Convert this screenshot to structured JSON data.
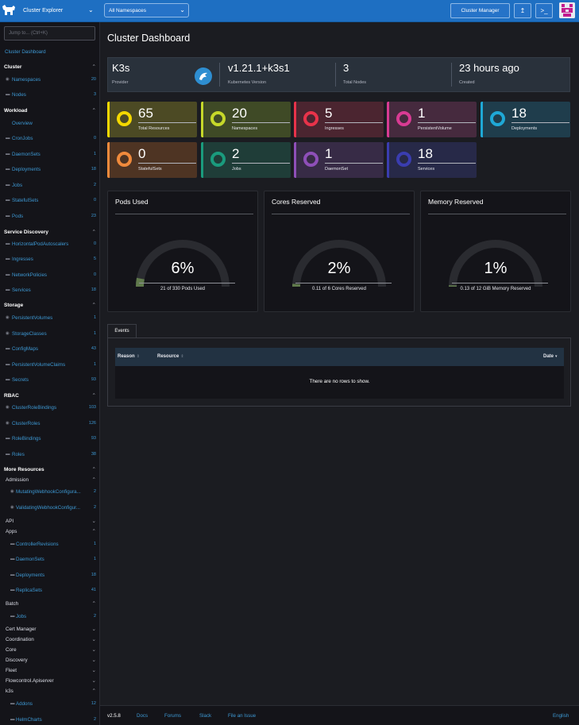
{
  "header": {
    "cluster_label": "Cluster Explorer",
    "namespace_select": "All Namespaces",
    "cluster_manager_label": "Cluster Manager",
    "colors": {
      "bar": "#1e6fc2",
      "border": "#8fb9e6"
    }
  },
  "sidebar": {
    "search_placeholder": "Jump to... (Ctrl+K)",
    "dashboard_link": "Cluster Dashboard",
    "groups": {
      "cluster": "Cluster",
      "workload": "Workload",
      "service_discovery": "Service Discovery",
      "storage": "Storage",
      "rbac": "RBAC",
      "more_resources": "More Resources",
      "admission": "Admission",
      "api": "API",
      "apps": "Apps",
      "batch": "Batch",
      "cert_manager": "Cert Manager",
      "coordination": "Coordination",
      "core": "Core",
      "discovery": "Discovery",
      "fleet": "Fleet",
      "flowcontrol": "Flowcontrol.Apiserver",
      "k3s": "k3s"
    },
    "items": {
      "namespaces": {
        "label": "Namespaces",
        "count": "20"
      },
      "nodes": {
        "label": "Nodes",
        "count": "3"
      },
      "overview": {
        "label": "Overview"
      },
      "cronjobs": {
        "label": "CronJobs",
        "count": "0"
      },
      "daemonsets": {
        "label": "DaemonSets",
        "count": "1"
      },
      "deployments": {
        "label": "Deployments",
        "count": "18"
      },
      "jobs": {
        "label": "Jobs",
        "count": "2"
      },
      "statefulsets": {
        "label": "StatefulSets",
        "count": "0"
      },
      "pods": {
        "label": "Pods",
        "count": "23"
      },
      "hpa": {
        "label": "HorizontalPodAutoscalers",
        "count": "0"
      },
      "ingresses": {
        "label": "Ingresses",
        "count": "5"
      },
      "networkpolicies": {
        "label": "NetworkPolicies",
        "count": "0"
      },
      "services": {
        "label": "Services",
        "count": "18"
      },
      "pv": {
        "label": "PersistentVolumes",
        "count": "1"
      },
      "storageclasses": {
        "label": "StorageClasses",
        "count": "1"
      },
      "configmaps": {
        "label": "ConfigMaps",
        "count": "43"
      },
      "pvc": {
        "label": "PersistentVolumeClaims",
        "count": "1"
      },
      "secrets": {
        "label": "Secrets",
        "count": "93"
      },
      "crb": {
        "label": "ClusterRoleBindings",
        "count": "103"
      },
      "clusterroles": {
        "label": "ClusterRoles",
        "count": "126"
      },
      "rolebindings": {
        "label": "RoleBindings",
        "count": "93"
      },
      "roles": {
        "label": "Roles",
        "count": "38"
      },
      "mutating": {
        "label": "MutatingWebhookConfigura...",
        "count": "2"
      },
      "validating": {
        "label": "ValidatingWebhookConfigur...",
        "count": "2"
      },
      "controllerrevisions": {
        "label": "ControllerRevisions",
        "count": "1"
      },
      "apps_daemonsets": {
        "label": "DaemonSets",
        "count": "1"
      },
      "apps_deployments": {
        "label": "Deployments",
        "count": "18"
      },
      "replicasets": {
        "label": "ReplicaSets",
        "count": "41"
      },
      "batch_jobs": {
        "label": "Jobs",
        "count": "2"
      },
      "addons": {
        "label": "Addons",
        "count": "12"
      },
      "helmcharts": {
        "label": "HelmCharts",
        "count": "2"
      }
    }
  },
  "main": {
    "title": "Cluster Dashboard",
    "info": [
      {
        "value": "K3s",
        "label": "Provider"
      },
      {
        "value": "v1.21.1+k3s1",
        "label": "Kubernetes Version"
      },
      {
        "value": "3",
        "label": "Total Nodes"
      },
      {
        "value": "23 hours ago",
        "label": "Created"
      }
    ],
    "tiles": [
      {
        "count": "65",
        "label": "Total Resources",
        "color": "#f4d800",
        "bg": "#4c4a24"
      },
      {
        "count": "20",
        "label": "Namespaces",
        "color": "#c6d82a",
        "bg": "#3f4a26"
      },
      {
        "count": "5",
        "label": "Ingresses",
        "color": "#e8334a",
        "bg": "#4b2530"
      },
      {
        "count": "1",
        "label": "PersistentVolume",
        "color": "#d83b93",
        "bg": "#462a3e"
      },
      {
        "count": "18",
        "label": "Deployments",
        "color": "#1fa8d6",
        "bg": "#1f3d4c"
      },
      {
        "count": "0",
        "label": "StatefulSets",
        "color": "#f08a3c",
        "bg": "#4e3423"
      },
      {
        "count": "2",
        "label": "Jobs",
        "color": "#1a9b7d",
        "bg": "#1f3d38"
      },
      {
        "count": "1",
        "label": "DaemonSet",
        "color": "#8e4fb8",
        "bg": "#372b46"
      },
      {
        "count": "18",
        "label": "Services",
        "color": "#3a3db0",
        "bg": "#272948"
      }
    ],
    "gauges": [
      {
        "title": "Pods Used",
        "pct": "6%",
        "value": 0.06,
        "sub": "21 of 330 Pods Used"
      },
      {
        "title": "Cores Reserved",
        "pct": "2%",
        "value": 0.02,
        "sub": "0.11 of 6 Cores Reserved"
      },
      {
        "title": "Memory Reserved",
        "pct": "1%",
        "value": 0.01,
        "sub": "0.13 of 12 GiB Memory Reserved"
      }
    ],
    "events": {
      "tab": "Events",
      "cols": {
        "reason": "Reason",
        "resource": "Resource",
        "date": "Date"
      },
      "empty": "There are no rows to show."
    }
  },
  "footer": {
    "version": "v2.5.8",
    "docs": "Docs",
    "forums": "Forums",
    "slack": "Slack",
    "issue": "File an Issue",
    "language": "English"
  }
}
